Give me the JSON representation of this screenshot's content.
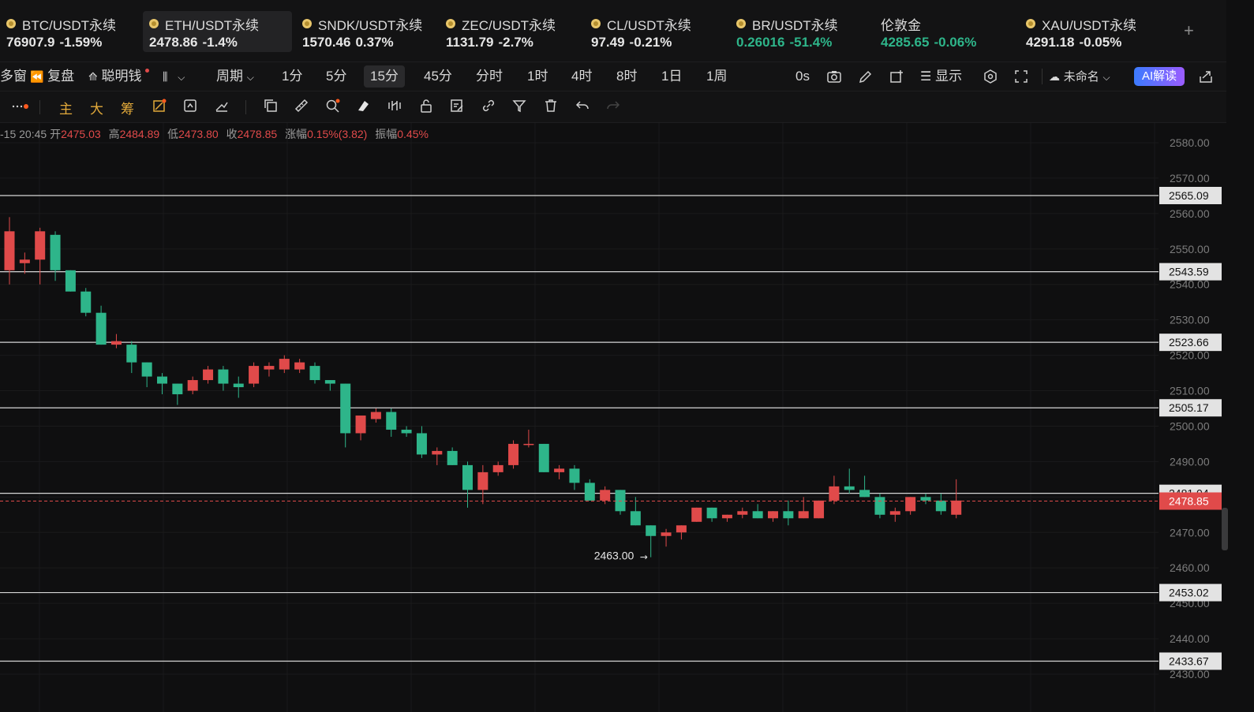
{
  "tickers": [
    {
      "name": "BTC/USDT永续",
      "price": "76907.9",
      "change": "-1.59%",
      "price_color": "white",
      "change_color": "white",
      "coin": true
    },
    {
      "name": "ETH/USDT永续",
      "price": "2478.86",
      "change": "-1.4%",
      "price_color": "white",
      "change_color": "white",
      "coin": true,
      "active": true
    },
    {
      "name": "SNDK/USDT永续",
      "price": "1570.46",
      "change": "0.37%",
      "price_color": "white",
      "change_color": "white",
      "coin": true
    },
    {
      "name": "ZEC/USDT永续",
      "price": "1131.79",
      "change": "-2.7%",
      "price_color": "white",
      "change_color": "white",
      "coin": true
    },
    {
      "name": "CL/USDT永续",
      "price": "97.49",
      "change": "-0.21%",
      "price_color": "white",
      "change_color": "white",
      "coin": true
    },
    {
      "name": "BR/USDT永续",
      "price": "0.26016",
      "change": "-51.4%",
      "price_color": "green",
      "change_color": "green",
      "coin": true
    },
    {
      "name": "伦敦金",
      "price": "4285.65",
      "change": "-0.06%",
      "price_color": "green",
      "change_color": "green",
      "coin": false
    },
    {
      "name": "XAU/USDT永续",
      "price": "4291.18",
      "change": "-0.05%",
      "price_color": "white",
      "change_color": "white",
      "coin": true
    }
  ],
  "add_ticker": "+",
  "toolbar1": {
    "multi_window": "多窗",
    "replay": "复盘",
    "smart_money": "聪明钱",
    "period": "周期",
    "intervals": [
      "1分",
      "5分",
      "15分",
      "45分",
      "分时",
      "1时",
      "4时",
      "8时",
      "1日",
      "1周"
    ],
    "selected_interval": "15分",
    "countdown": "0s",
    "display": "显示",
    "layout_name": "未命名",
    "ai_label": "AI解读"
  },
  "toolbar2": {
    "main": "主",
    "large": "大",
    "chips": "筹"
  },
  "ohlc": {
    "time": "-15 20:45",
    "open_label": "开",
    "open": "2475.03",
    "high_label": "高",
    "high": "2484.89",
    "low_label": "低",
    "low": "2473.80",
    "close_label": "收",
    "close": "2478.85",
    "change_label": "涨幅",
    "change": "0.15%(3.82)",
    "amplitude_label": "振幅",
    "amplitude": "0.45%"
  },
  "chart_data": {
    "type": "candlestick",
    "y_range": [
      2428,
      2586
    ],
    "y_ticks": [
      "2430.00",
      "2440.00",
      "2450.00",
      "2460.00",
      "2470.00",
      "2480.00",
      "2490.00",
      "2500.00",
      "2510.00",
      "2520.00",
      "2530.00",
      "2540.00",
      "2550.00",
      "2560.00",
      "2570.00",
      "2580.00"
    ],
    "horizontal_lines": [
      "2565.09",
      "2543.59",
      "2523.66",
      "2505.17",
      "2481.04",
      "2453.02",
      "2433.67"
    ],
    "current_price": "2478.85",
    "low_marker": "2463.00",
    "candles": [
      {
        "o": 2544,
        "h": 2559,
        "l": 2540,
        "c": 2555
      },
      {
        "o": 2546,
        "h": 2549,
        "l": 2543,
        "c": 2547
      },
      {
        "o": 2547,
        "h": 2556,
        "l": 2540,
        "c": 2555
      },
      {
        "o": 2554,
        "h": 2555,
        "l": 2541,
        "c": 2544
      },
      {
        "o": 2544,
        "h": 2544,
        "l": 2538,
        "c": 2538
      },
      {
        "o": 2538,
        "h": 2539,
        "l": 2531,
        "c": 2532
      },
      {
        "o": 2532,
        "h": 2534,
        "l": 2523,
        "c": 2523
      },
      {
        "o": 2523,
        "h": 2526,
        "l": 2522,
        "c": 2524
      },
      {
        "o": 2523,
        "h": 2524,
        "l": 2515,
        "c": 2518
      },
      {
        "o": 2518,
        "h": 2518,
        "l": 2511,
        "c": 2514
      },
      {
        "o": 2514,
        "h": 2515,
        "l": 2509,
        "c": 2512
      },
      {
        "o": 2512,
        "h": 2512,
        "l": 2506,
        "c": 2509
      },
      {
        "o": 2510,
        "h": 2514,
        "l": 2509,
        "c": 2513
      },
      {
        "o": 2513,
        "h": 2517,
        "l": 2512,
        "c": 2516
      },
      {
        "o": 2516,
        "h": 2517,
        "l": 2510,
        "c": 2512
      },
      {
        "o": 2512,
        "h": 2514,
        "l": 2508,
        "c": 2511
      },
      {
        "o": 2512,
        "h": 2518,
        "l": 2511,
        "c": 2517
      },
      {
        "o": 2516,
        "h": 2518,
        "l": 2514,
        "c": 2517
      },
      {
        "o": 2516,
        "h": 2520,
        "l": 2515,
        "c": 2519
      },
      {
        "o": 2516,
        "h": 2519,
        "l": 2515,
        "c": 2518
      },
      {
        "o": 2517,
        "h": 2518,
        "l": 2512,
        "c": 2513
      },
      {
        "o": 2513,
        "h": 2513,
        "l": 2510,
        "c": 2512
      },
      {
        "o": 2512,
        "h": 2512,
        "l": 2494,
        "c": 2498
      },
      {
        "o": 2498,
        "h": 2503,
        "l": 2496,
        "c": 2503
      },
      {
        "o": 2502,
        "h": 2505,
        "l": 2501,
        "c": 2504
      },
      {
        "o": 2504,
        "h": 2505,
        "l": 2497,
        "c": 2499
      },
      {
        "o": 2499,
        "h": 2500,
        "l": 2497,
        "c": 2498
      },
      {
        "o": 2498,
        "h": 2500,
        "l": 2491,
        "c": 2492
      },
      {
        "o": 2492,
        "h": 2494,
        "l": 2489,
        "c": 2493
      },
      {
        "o": 2493,
        "h": 2494,
        "l": 2489,
        "c": 2489
      },
      {
        "o": 2489,
        "h": 2490,
        "l": 2477,
        "c": 2482
      },
      {
        "o": 2482,
        "h": 2489,
        "l": 2478,
        "c": 2487
      },
      {
        "o": 2487,
        "h": 2490,
        "l": 2486,
        "c": 2489
      },
      {
        "o": 2489,
        "h": 2496,
        "l": 2488,
        "c": 2495
      },
      {
        "o": 2495,
        "h": 2499,
        "l": 2494,
        "c": 2495
      },
      {
        "o": 2495,
        "h": 2495,
        "l": 2487,
        "c": 2487
      },
      {
        "o": 2487,
        "h": 2489,
        "l": 2485,
        "c": 2488
      },
      {
        "o": 2488,
        "h": 2489,
        "l": 2482,
        "c": 2484
      },
      {
        "o": 2484,
        "h": 2485,
        "l": 2479,
        "c": 2479
      },
      {
        "o": 2479,
        "h": 2483,
        "l": 2478,
        "c": 2482
      },
      {
        "o": 2482,
        "h": 2482,
        "l": 2475,
        "c": 2476
      },
      {
        "o": 2476,
        "h": 2480,
        "l": 2472,
        "c": 2472
      },
      {
        "o": 2472,
        "h": 2472,
        "l": 2463,
        "c": 2469
      },
      {
        "o": 2469,
        "h": 2471,
        "l": 2466,
        "c": 2470
      },
      {
        "o": 2470,
        "h": 2472,
        "l": 2468,
        "c": 2472
      },
      {
        "o": 2473,
        "h": 2477,
        "l": 2473,
        "c": 2477
      },
      {
        "o": 2477,
        "h": 2477,
        "l": 2473,
        "c": 2474
      },
      {
        "o": 2474,
        "h": 2475,
        "l": 2473,
        "c": 2475
      },
      {
        "o": 2475,
        "h": 2477,
        "l": 2474,
        "c": 2476
      },
      {
        "o": 2476,
        "h": 2478,
        "l": 2474,
        "c": 2474
      },
      {
        "o": 2474,
        "h": 2476,
        "l": 2473,
        "c": 2476
      },
      {
        "o": 2476,
        "h": 2479,
        "l": 2472,
        "c": 2474
      },
      {
        "o": 2474,
        "h": 2480,
        "l": 2474,
        "c": 2476
      },
      {
        "o": 2474,
        "h": 2479,
        "l": 2474,
        "c": 2479
      },
      {
        "o": 2479,
        "h": 2486,
        "l": 2478,
        "c": 2483
      },
      {
        "o": 2483,
        "h": 2488,
        "l": 2481,
        "c": 2482
      },
      {
        "o": 2482,
        "h": 2486,
        "l": 2480,
        "c": 2480
      },
      {
        "o": 2480,
        "h": 2481,
        "l": 2474,
        "c": 2475
      },
      {
        "o": 2475,
        "h": 2477,
        "l": 2473,
        "c": 2476
      },
      {
        "o": 2476,
        "h": 2480,
        "l": 2475,
        "c": 2480
      },
      {
        "o": 2480,
        "h": 2481,
        "l": 2478,
        "c": 2479
      },
      {
        "o": 2479,
        "h": 2481,
        "l": 2475,
        "c": 2476
      },
      {
        "o": 2475,
        "h": 2485,
        "l": 2474,
        "c": 2479
      }
    ],
    "colors": {
      "up": "#e04a4a",
      "down": "#2eb58a"
    }
  }
}
